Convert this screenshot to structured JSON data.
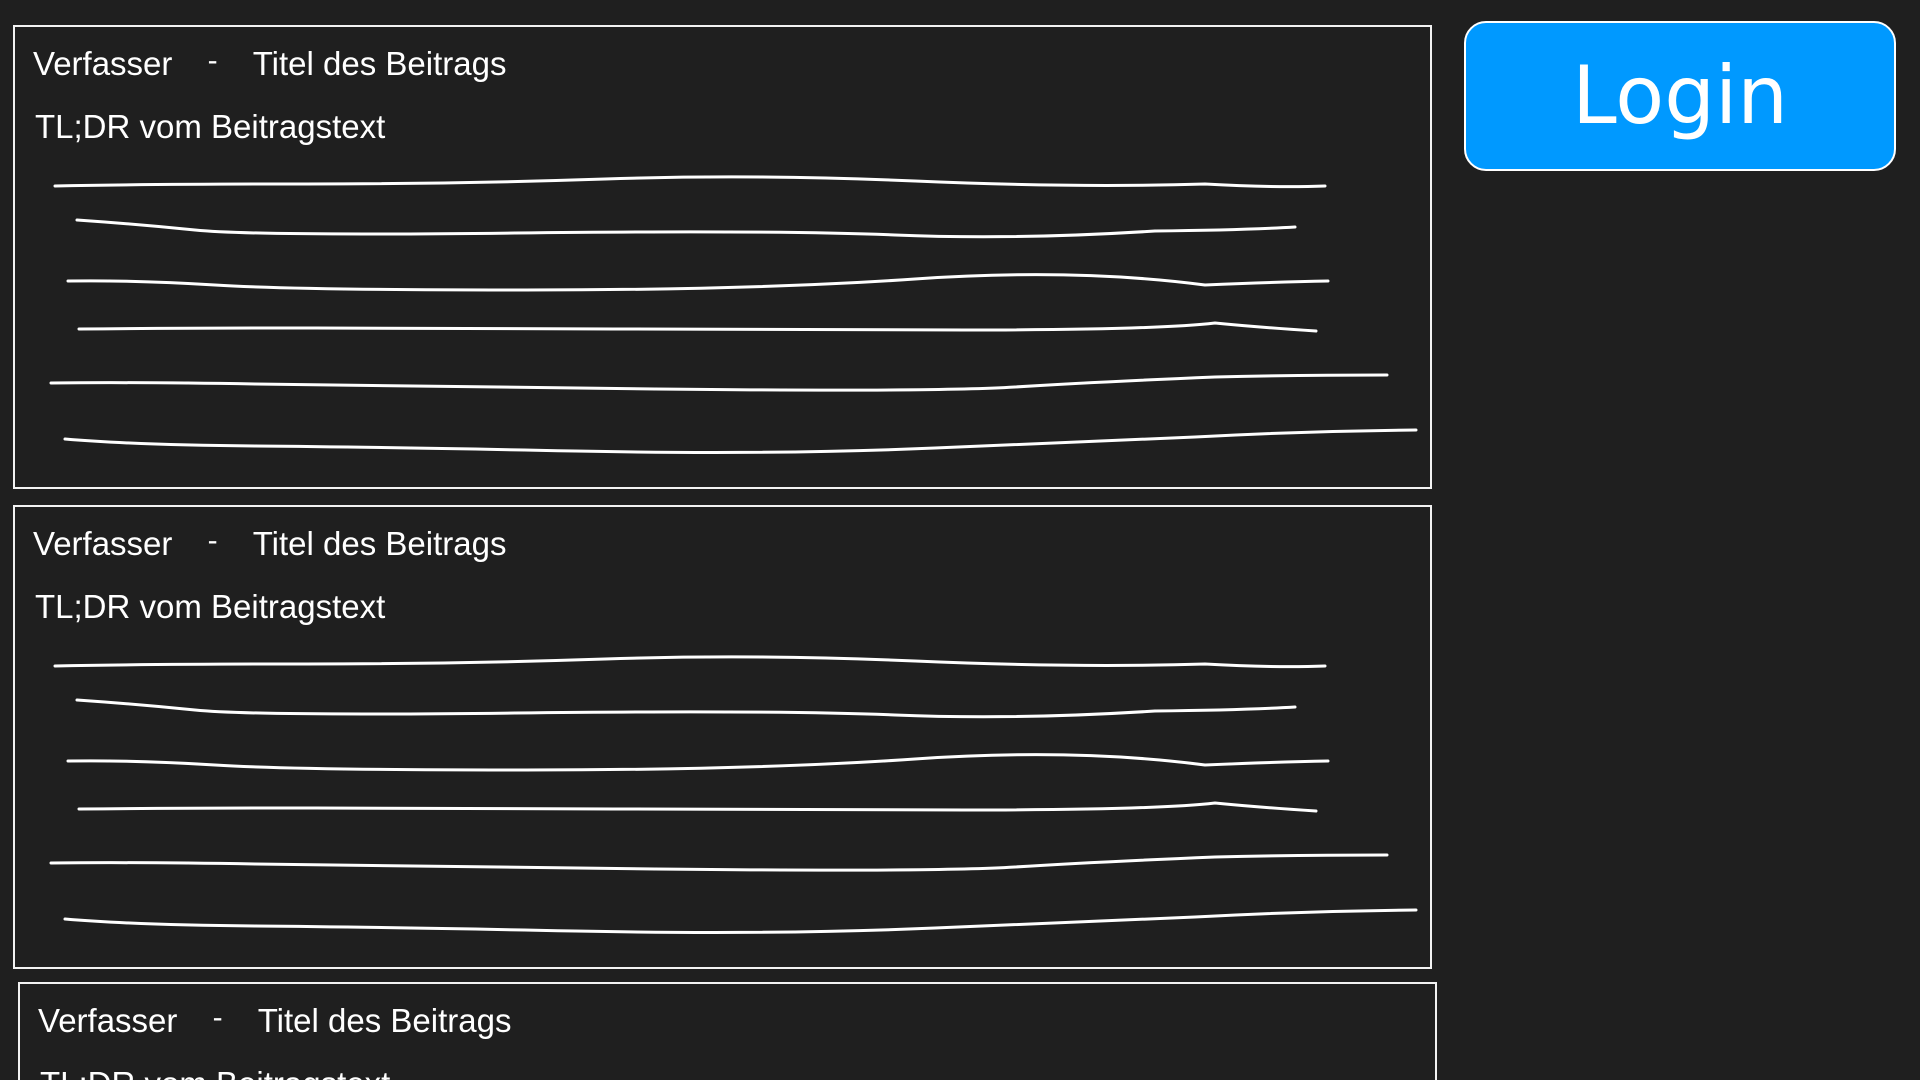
{
  "posts": [
    {
      "author": "Verfasser",
      "separator": "-",
      "title": "Titel des Beitrags",
      "summary": "TL;DR vom Beitragstext"
    },
    {
      "author": "Verfasser",
      "separator": "-",
      "title": "Titel des Beitrags",
      "summary": "TL;DR vom Beitragstext"
    },
    {
      "author": "Verfasser",
      "separator": "-",
      "title": "Titel des Beitrags",
      "summary": "TL;DR vom Beitragstext"
    }
  ],
  "login": {
    "label": "Login",
    "color": "#0099ff"
  },
  "colors": {
    "background": "#1f1f1f",
    "border": "#f2f2f2",
    "text": "#ffffff"
  }
}
